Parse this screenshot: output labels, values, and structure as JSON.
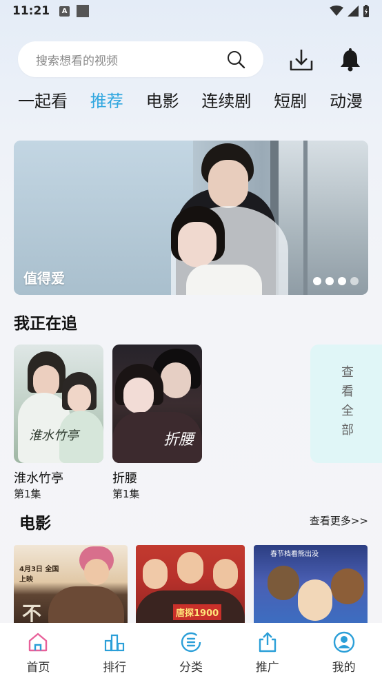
{
  "status_bar": {
    "time": "11:21",
    "app_badge": "A"
  },
  "search": {
    "placeholder": "搜索想看的视频"
  },
  "icons": {
    "search": "search-icon",
    "download": "download-icon",
    "notification": "bell-icon"
  },
  "tabs": [
    {
      "label": "一起看",
      "active": false
    },
    {
      "label": "推荐",
      "active": true
    },
    {
      "label": "电影",
      "active": false
    },
    {
      "label": "连续剧",
      "active": false
    },
    {
      "label": "短剧",
      "active": false
    },
    {
      "label": "动漫",
      "active": false
    }
  ],
  "banner": {
    "title": "值得爱",
    "slide_count": 4,
    "active_slide": 1
  },
  "following": {
    "title": "我正在追",
    "view_all": "查看全部",
    "items": [
      {
        "name": "淮水竹亭",
        "episode": "第1集",
        "poster_text": "淮水竹亭"
      },
      {
        "name": "折腰",
        "episode": "第1集",
        "poster_text": "折腰"
      }
    ]
  },
  "movies": {
    "title": "电影",
    "more": "查看更多>>",
    "posters": [
      {
        "top_text": "4月3日 全国上映",
        "art_text": "不"
      },
      {
        "art_text": "唐探1900"
      },
      {
        "top_text": "春节档看熊出没"
      }
    ]
  },
  "bottom_nav": [
    {
      "label": "首页",
      "icon": "home-icon",
      "active": true
    },
    {
      "label": "排行",
      "icon": "ranking-icon",
      "active": false
    },
    {
      "label": "分类",
      "icon": "category-icon",
      "active": false
    },
    {
      "label": "推广",
      "icon": "share-icon",
      "active": false
    },
    {
      "label": "我的",
      "icon": "profile-icon",
      "active": false
    }
  ],
  "colors": {
    "accent": "#2fa6df",
    "home_active": "#e8609a",
    "nav_icon": "#2b9fd8",
    "view_all_bg": "#e0f6f7"
  }
}
